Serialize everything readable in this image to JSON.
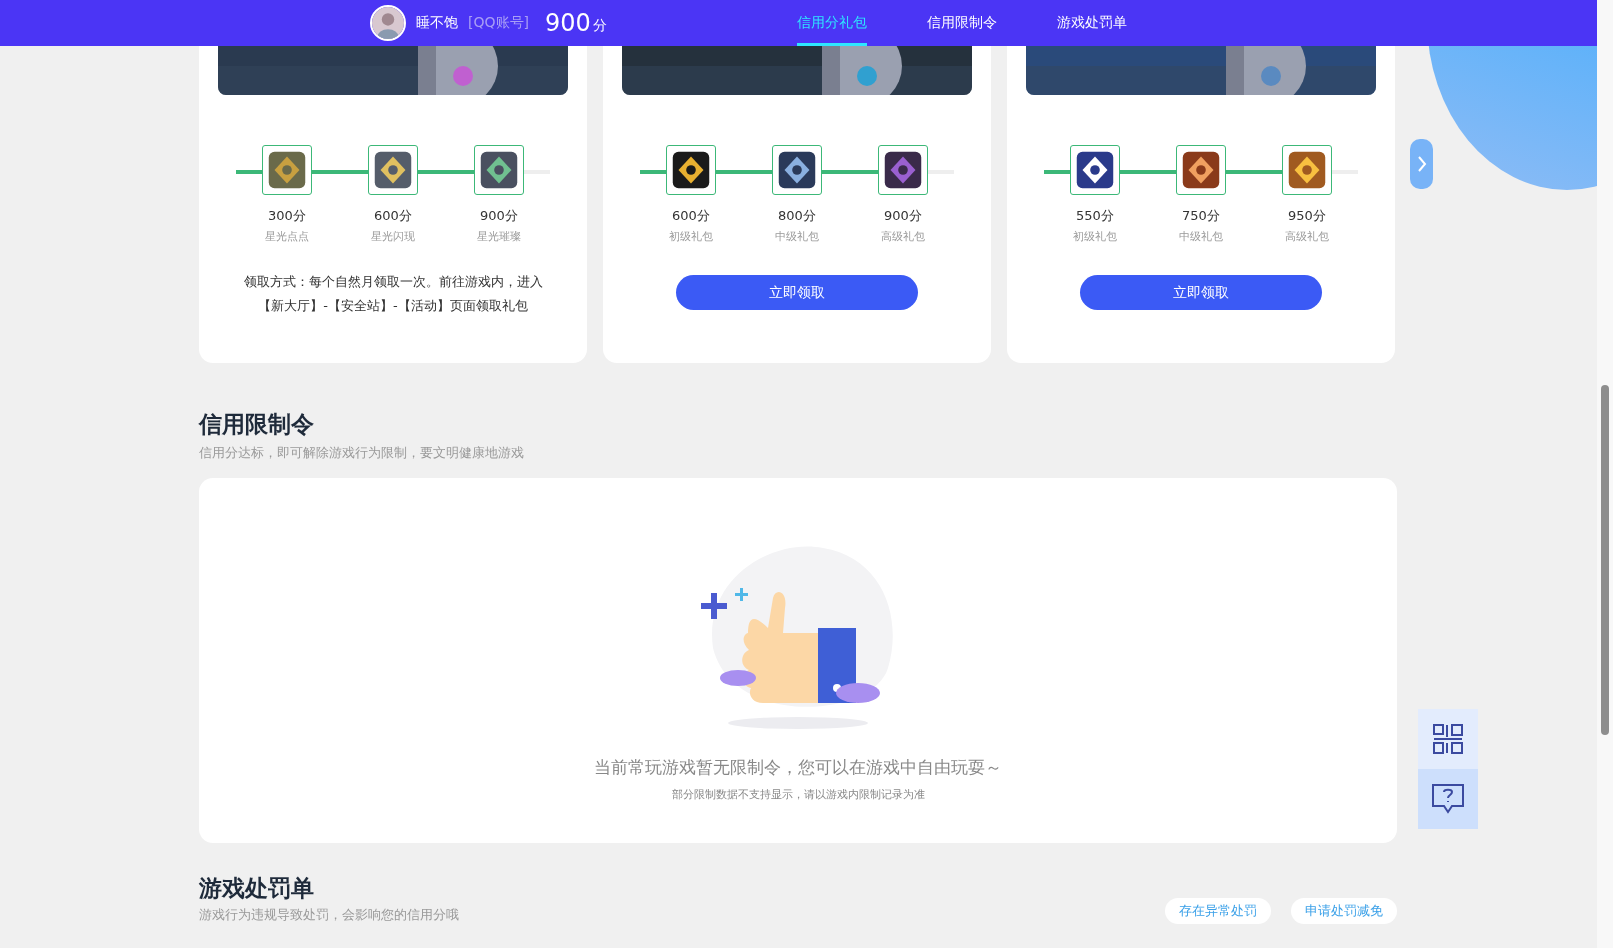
{
  "header": {
    "username": "睡不饱",
    "account_type": "[QQ账号]",
    "score": "900",
    "score_unit": "分",
    "nav": [
      {
        "label": "信用分礼包",
        "selected": true
      },
      {
        "label": "信用限制令",
        "selected": false
      },
      {
        "label": "游戏处罚单",
        "selected": false
      }
    ]
  },
  "gift_cards": [
    {
      "kind": "note",
      "tiers": [
        {
          "points": "300分",
          "name": "星光点点"
        },
        {
          "points": "600分",
          "name": "星光闪现"
        },
        {
          "points": "900分",
          "name": "星光璀璨"
        }
      ],
      "note": "领取方式：每个自然月领取一次。前往游戏内，进入【新大厅】-【安全站】-【活动】页面领取礼包"
    },
    {
      "kind": "button",
      "tiers": [
        {
          "points": "600分",
          "name": "初级礼包"
        },
        {
          "points": "800分",
          "name": "中级礼包"
        },
        {
          "points": "900分",
          "name": "高级礼包"
        }
      ],
      "button": "立即领取"
    },
    {
      "kind": "button",
      "tiers": [
        {
          "points": "550分",
          "name": "初级礼包"
        },
        {
          "points": "750分",
          "name": "中级礼包"
        },
        {
          "points": "950分",
          "name": "高级礼包"
        }
      ],
      "button": "立即领取"
    }
  ],
  "restriction": {
    "title": "信用限制令",
    "subtitle": "信用分达标，即可解除游戏行为限制，要文明健康地游戏",
    "empty_message": "当前常玩游戏暂无限制令，您可以在游戏中自由玩耍～",
    "empty_note": "部分限制数据不支持显示，请以游戏内限制记录为准"
  },
  "penalty": {
    "title": "游戏处罚单",
    "subtitle": "游戏行为违规导致处罚，会影响您的信用分哦",
    "buttons": [
      "存在异常处罚",
      "申请处罚减免"
    ]
  }
}
